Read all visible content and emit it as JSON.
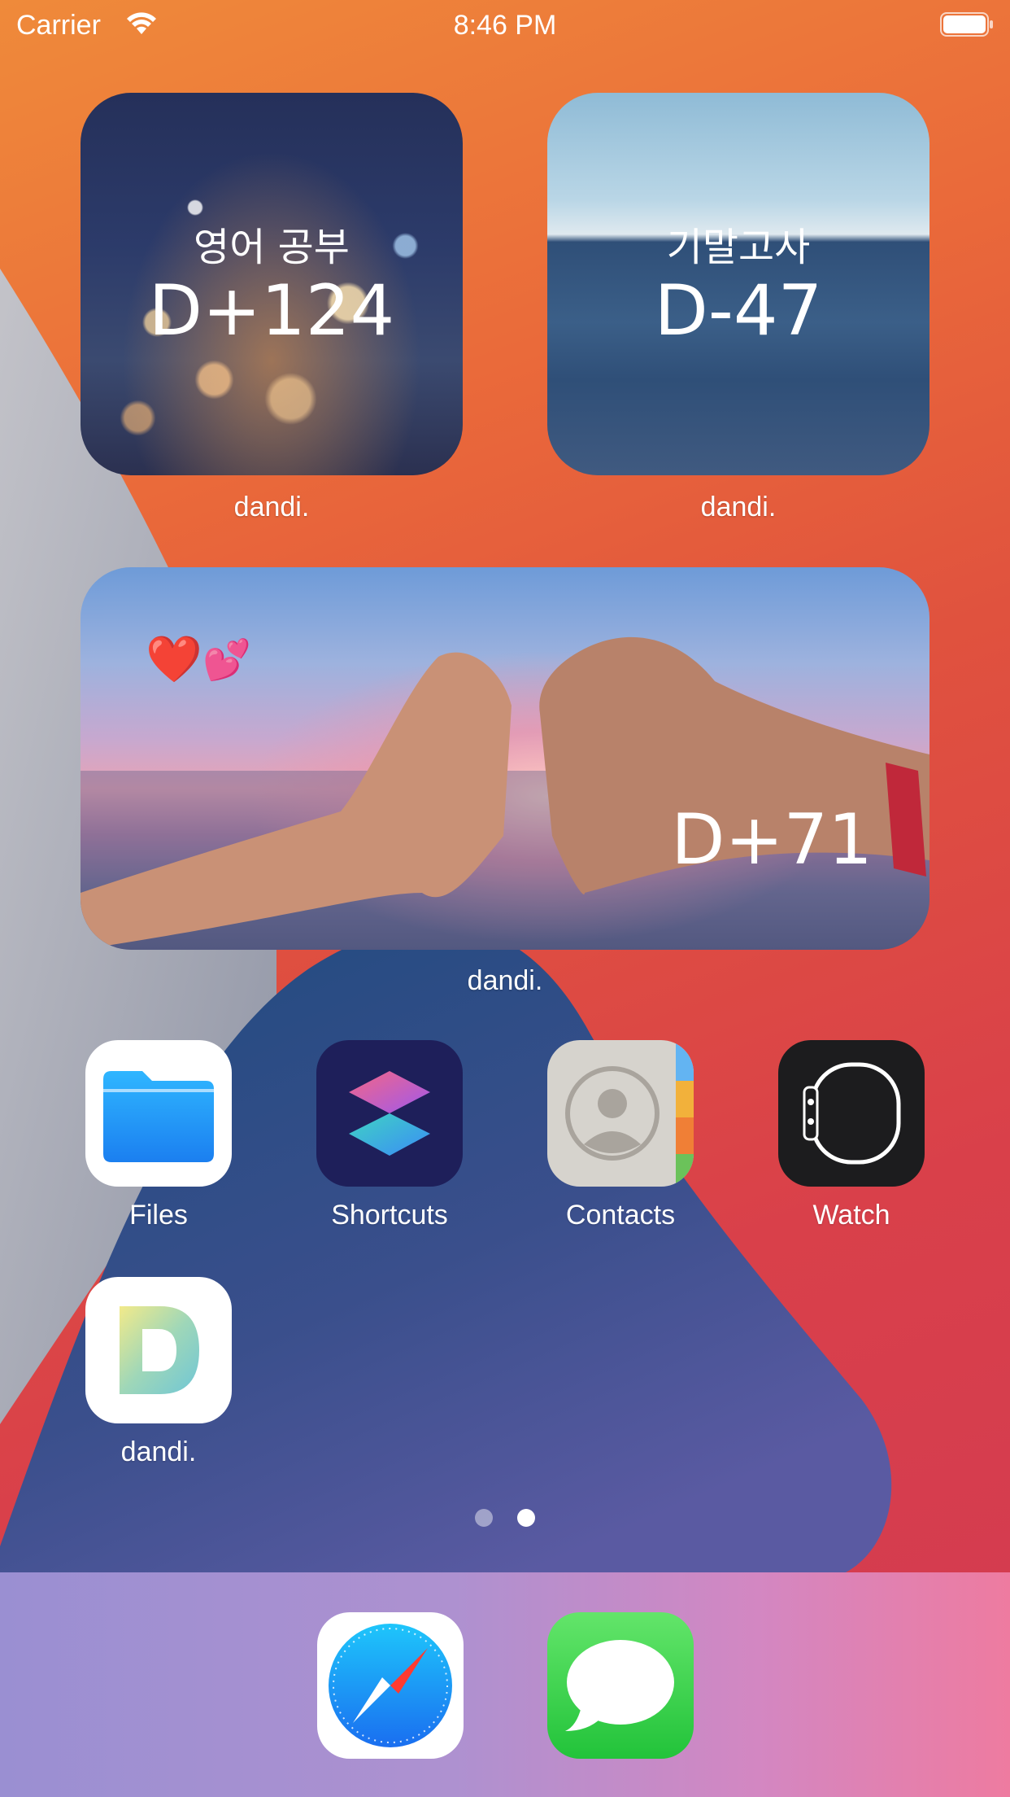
{
  "status_bar": {
    "carrier": "Carrier",
    "time": "8:46 PM"
  },
  "widgets": [
    {
      "title": "영어 공부",
      "count": "D+124",
      "label": "dandi."
    },
    {
      "title": "기말고사",
      "count": "D-47",
      "label": "dandi."
    },
    {
      "emoji": "❤️",
      "emoji2": "💕",
      "count": "D+71",
      "label": "dandi."
    }
  ],
  "apps": [
    {
      "label": "Files",
      "icon": "files-icon"
    },
    {
      "label": "Shortcuts",
      "icon": "shortcuts-icon"
    },
    {
      "label": "Contacts",
      "icon": "contacts-icon"
    },
    {
      "label": "Watch",
      "icon": "watch-icon"
    },
    {
      "label": "dandi.",
      "icon": "dandi-icon"
    }
  ],
  "page_indicator": {
    "pages": 2,
    "current": 2
  },
  "dock": [
    {
      "icon": "safari-icon"
    },
    {
      "icon": "messages-icon"
    }
  ],
  "colors": {
    "dock_start": "#9a8fd2",
    "dock_end": "#ee7ba0",
    "wallpaper_red": "#d9404a",
    "wallpaper_blue": "#2c4a7a"
  }
}
